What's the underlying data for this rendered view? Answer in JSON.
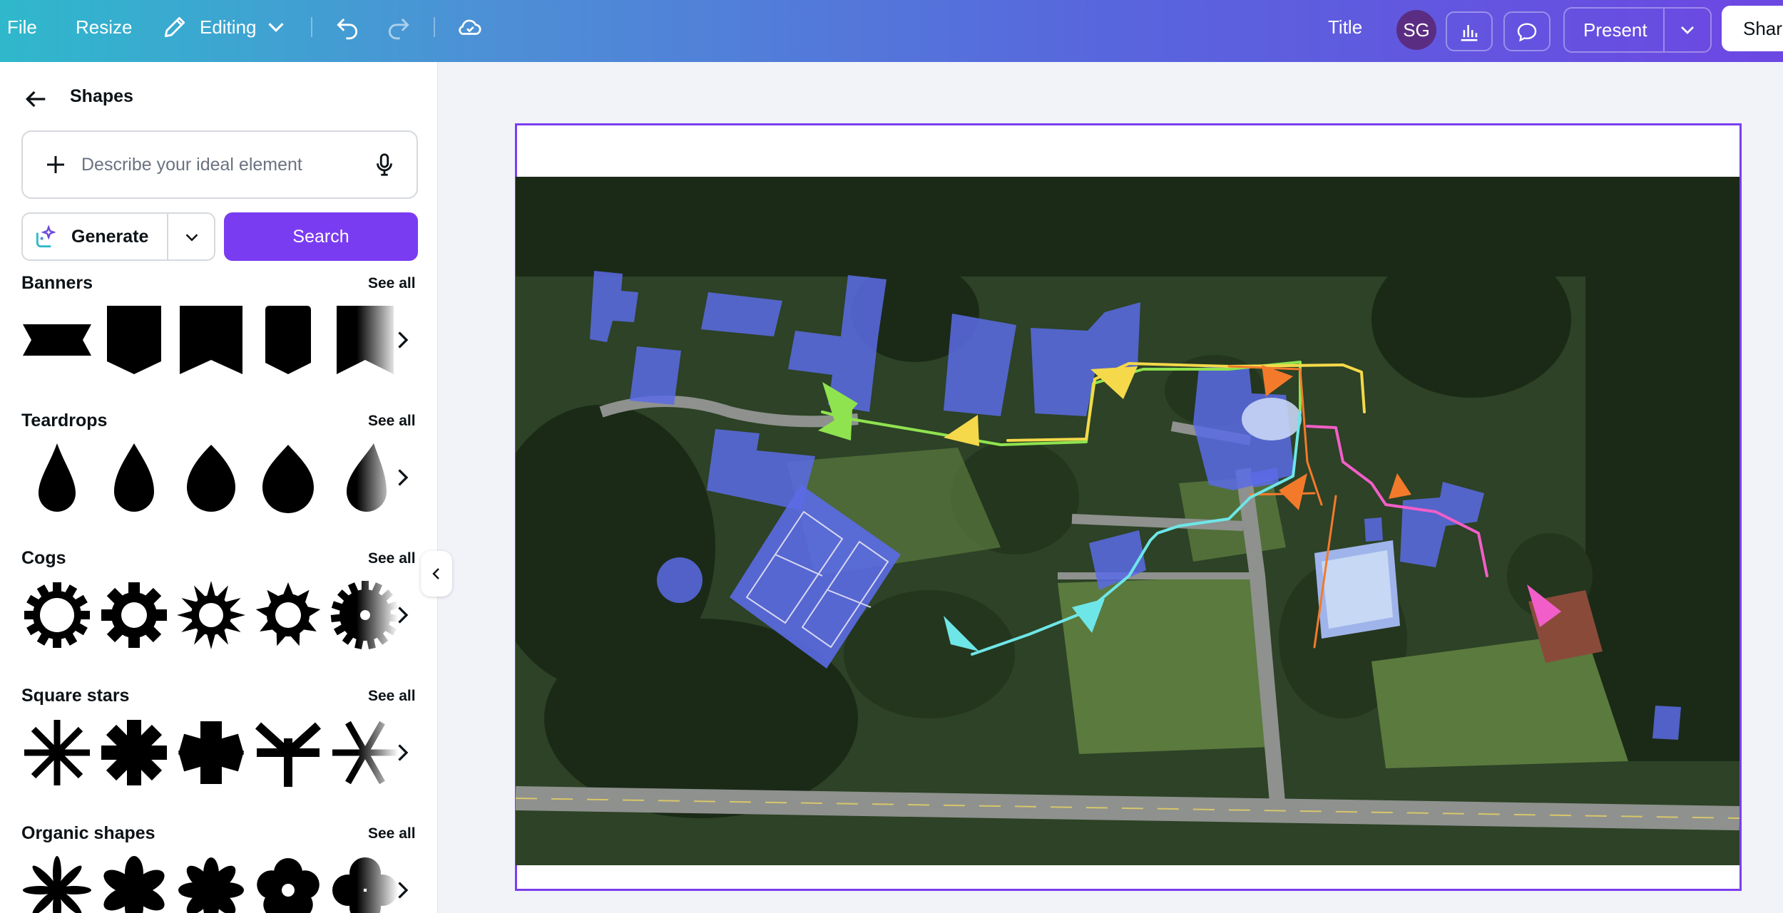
{
  "topbar": {
    "file_label": "File",
    "resize_label": "Resize",
    "editing_label": "Editing",
    "title_label": "Title",
    "avatar_initials": "SG",
    "present_label": "Present",
    "share_label": "Share",
    "icons": [
      "pencil-icon",
      "chevron-down-icon",
      "undo-icon",
      "redo-icon",
      "cloud-check-icon",
      "analytics-icon",
      "comment-icon"
    ]
  },
  "panel": {
    "title": "Shapes",
    "search": {
      "placeholder": "Describe your ideal element"
    },
    "generate_label": "Generate",
    "search_button_label": "Search",
    "see_all_label": "See all",
    "sections": [
      {
        "title": "Banners"
      },
      {
        "title": "Teardrops"
      },
      {
        "title": "Cogs"
      },
      {
        "title": "Square stars"
      },
      {
        "title": "Organic shapes"
      }
    ]
  },
  "colors": {
    "accent": "#7b3ef0",
    "building_overlay": "#5b6be6",
    "route_green": "#8fe34f",
    "route_yellow": "#f5d94a",
    "route_orange": "#f47a2b",
    "route_cyan": "#6ee6e8",
    "route_pink": "#f25ec9"
  }
}
